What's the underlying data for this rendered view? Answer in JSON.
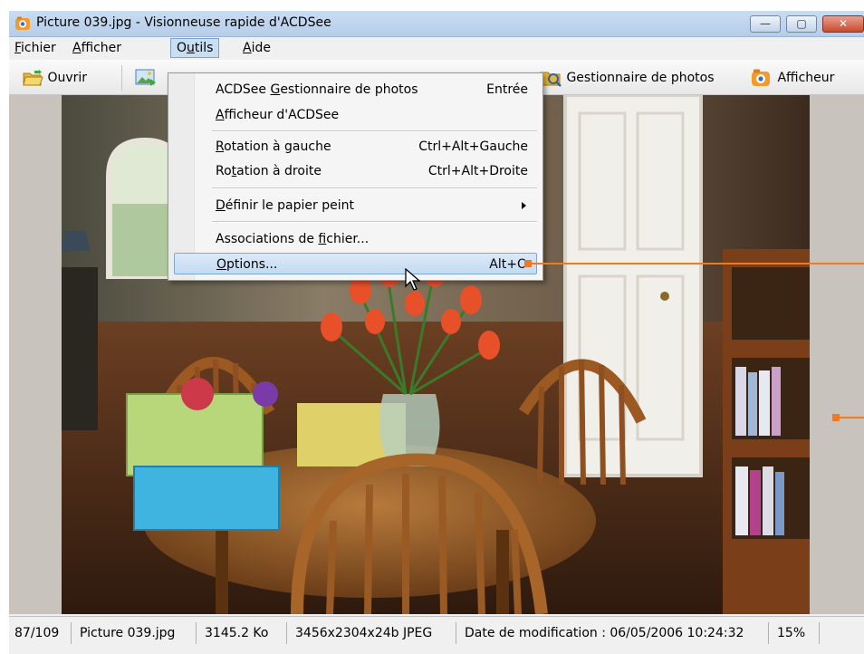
{
  "window": {
    "title": "Picture 039.jpg - Visionneuse rapide d'ACDSee",
    "controls": {
      "minimize": "—",
      "maximize": "▢",
      "close": "✕"
    }
  },
  "menubar": {
    "items": [
      {
        "pre": "",
        "u": "F",
        "post": "ichier"
      },
      {
        "pre": "",
        "u": "A",
        "post": "fficher"
      },
      {
        "pre": "O",
        "u": "u",
        "post": "tils"
      },
      {
        "pre": "",
        "u": "A",
        "post": "ide"
      }
    ]
  },
  "toolbar": {
    "open": "Ouvrir",
    "photo_manager": "Gestionnaire de photos",
    "viewer": "Afficheur"
  },
  "menu_outils": {
    "items": [
      {
        "pre": "ACDSee ",
        "u": "G",
        "post": "estionnaire de photos",
        "shortcut": "Entrée"
      },
      {
        "pre": "",
        "u": "A",
        "post": "fficheur d'ACDSee",
        "shortcut": ""
      },
      {
        "pre": "",
        "u": "R",
        "post": "otation à gauche",
        "shortcut": "Ctrl+Alt+Gauche"
      },
      {
        "pre": "Ro",
        "u": "t",
        "post": "ation à  droite",
        "shortcut": "Ctrl+Alt+Droite"
      },
      {
        "pre": "",
        "u": "D",
        "post": "éfinir le papier peint",
        "shortcut": ""
      },
      {
        "pre": "Associations de ",
        "u": "f",
        "post": "ichier...",
        "shortcut": ""
      },
      {
        "pre": "",
        "u": "O",
        "post": "ptions...",
        "shortcut": "Alt+O"
      }
    ]
  },
  "statusbar": {
    "index": "87/109",
    "filename": "Picture 039.jpg",
    "filesize": "3145.2 Ko",
    "dimensions": "3456x2304x24b JPEG",
    "modified": "Date de modification : 06/05/2006 10:24:32",
    "zoom": "15%"
  },
  "colors": {
    "callout": "#f07a22",
    "menu_highlight": "#c3dbf3",
    "titlebar": "#c9dcf2"
  }
}
